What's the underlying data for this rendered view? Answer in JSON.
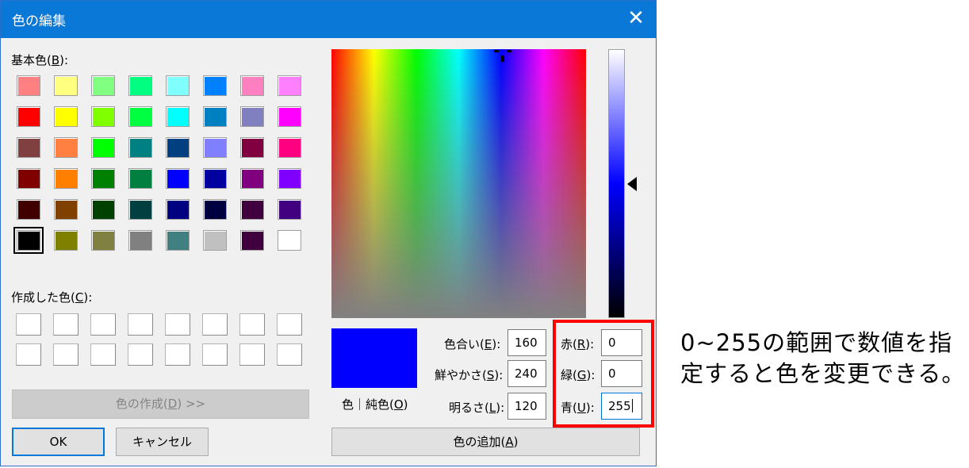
{
  "dialog": {
    "title": "色の編集",
    "close_label": "✕"
  },
  "basic_colors": {
    "label": "基本色",
    "accel": "B",
    "selected_index": 40,
    "colors": [
      "#ff8080",
      "#ffff80",
      "#80ff80",
      "#00ff80",
      "#80ffff",
      "#0080ff",
      "#ff80c0",
      "#ff80ff",
      "#ff0000",
      "#ffff00",
      "#80ff00",
      "#00ff40",
      "#00ffff",
      "#0080c0",
      "#8080c0",
      "#ff00ff",
      "#804040",
      "#ff8040",
      "#00ff00",
      "#008080",
      "#004080",
      "#8080ff",
      "#800040",
      "#ff0080",
      "#800000",
      "#ff8000",
      "#008000",
      "#008040",
      "#0000ff",
      "#0000a0",
      "#800080",
      "#8000ff",
      "#400000",
      "#804000",
      "#004000",
      "#004040",
      "#000080",
      "#000040",
      "#400040",
      "#400080",
      "#000000",
      "#808000",
      "#808040",
      "#808080",
      "#408080",
      "#c0c0c0",
      "#400040",
      "#ffffff"
    ]
  },
  "custom_colors": {
    "label": "作成した色",
    "accel": "C",
    "count": 16
  },
  "define_button": {
    "label_pre": "色の作成(",
    "accel": "D",
    "label_post": ") >>"
  },
  "ok_button": {
    "label": "OK"
  },
  "cancel_button": {
    "label": "キャンセル"
  },
  "preview": {
    "color": "#0000ff",
    "label_pre": "色｜純色(",
    "accel": "O",
    "label_post": ")"
  },
  "hsl": {
    "hue": {
      "label_pre": "色合い(",
      "accel": "E",
      "label_post": "):",
      "value": "160"
    },
    "sat": {
      "label_pre": "鮮やかさ(",
      "accel": "S",
      "label_post": "):",
      "value": "240"
    },
    "lum": {
      "label_pre": "明るさ(",
      "accel": "L",
      "label_post": "):",
      "value": "120"
    }
  },
  "rgb": {
    "red": {
      "label_pre": "赤(",
      "accel": "R",
      "label_post": "):",
      "value": "0"
    },
    "green": {
      "label_pre": "緑(",
      "accel": "G",
      "label_post": "):",
      "value": "0"
    },
    "blue": {
      "label_pre": "青(",
      "accel": "U",
      "label_post": "):",
      "value": "255"
    }
  },
  "add_button": {
    "label_pre": "色の追加(",
    "accel": "A",
    "label_post": ")"
  },
  "annotation": {
    "text": "0~255の範囲で数値を指定すると色を変更できる。",
    "highlight_color": "#ff0000"
  }
}
